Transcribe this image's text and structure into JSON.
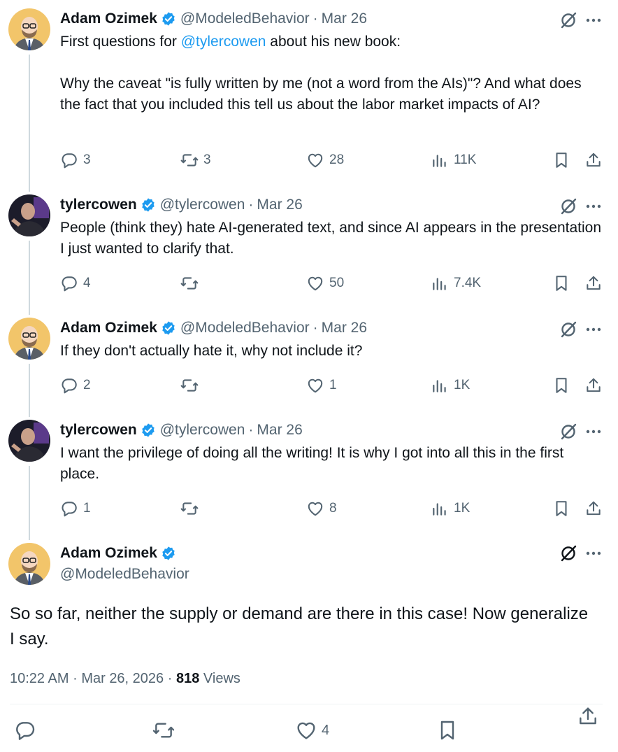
{
  "posts": [
    {
      "name": "Adam Ozimek",
      "handle": "@ModeledBehavior",
      "date": "Mar 26",
      "text_parts": {
        "p1_pre": "First questions for ",
        "p1_mention": "@tylercowen",
        "p1_post": " about his new book:",
        "p2": "Why the caveat \"is fully written by me (not a word from the AIs)\"? And what does the fact that you included this tell us about the labor market impacts of AI?"
      },
      "replies": "3",
      "reposts": "3",
      "likes": "28",
      "views": "11K"
    },
    {
      "name": "tylercowen",
      "handle": "@tylercowen",
      "date": "Mar 26",
      "text": "People (think they) hate AI-generated text, and since AI appears in the presentation I just wanted to clarify that.",
      "replies": "4",
      "reposts": "",
      "likes": "50",
      "views": "7.4K"
    },
    {
      "name": "Adam Ozimek",
      "handle": "@ModeledBehavior",
      "date": "Mar 26",
      "text": "If they don't actually hate it, why not include it?",
      "replies": "2",
      "reposts": "",
      "likes": "1",
      "views": "1K"
    },
    {
      "name": "tylercowen",
      "handle": "@tylercowen",
      "date": "Mar 26",
      "text": "I want the privilege of doing all the writing! It is why I got into all this in the first place.",
      "replies": "1",
      "reposts": "",
      "likes": "8",
      "views": "1K"
    }
  ],
  "focused": {
    "name": "Adam Ozimek",
    "handle": "@ModeledBehavior",
    "text": "So so far, neither the supply or demand are there in this case! Now generalize I say.",
    "time": "10:22 AM",
    "date": "Mar 26, 2026",
    "views_count": "818",
    "views_label": "Views",
    "likes": "4"
  },
  "separator": "·",
  "colors": {
    "accent": "#1d9bf0",
    "secondary_text": "#536471",
    "thread_line": "#cfd9de"
  },
  "icons": [
    "verified-badge-icon",
    "grok-icon",
    "more-icon",
    "reply-icon",
    "repost-icon",
    "like-icon",
    "views-icon",
    "bookmark-icon",
    "share-icon"
  ]
}
